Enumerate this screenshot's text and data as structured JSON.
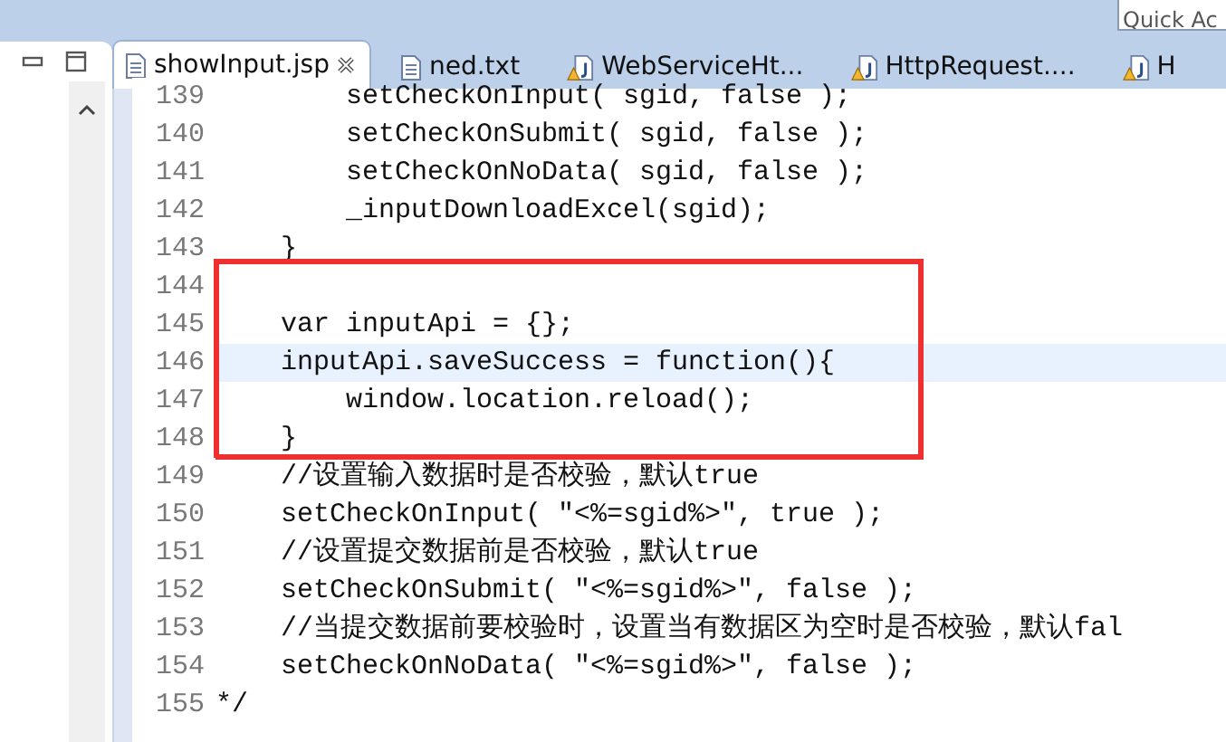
{
  "quick_access": {
    "placeholder": "Quick Ac"
  },
  "tabs": [
    {
      "label": "showInput.jsp",
      "kind": "text",
      "selected": true
    },
    {
      "label": "ned.txt",
      "kind": "text",
      "selected": false
    },
    {
      "label": "WebServiceHt...",
      "kind": "java",
      "selected": false
    },
    {
      "label": "HttpRequest....",
      "kind": "java",
      "selected": false
    },
    {
      "label": "H",
      "kind": "java",
      "selected": false
    }
  ],
  "editor": {
    "blocks": [
      {
        "boxed": false,
        "lines": [
          {
            "number": "139",
            "text": "        setCheckOnInput( sgid, false );",
            "current": false
          },
          {
            "number": "140",
            "text": "        setCheckOnSubmit( sgid, false );",
            "current": false
          },
          {
            "number": "141",
            "text": "        setCheckOnNoData( sgid, false );",
            "current": false
          },
          {
            "number": "142",
            "text": "        _inputDownloadExcel(sgid);",
            "current": false
          },
          {
            "number": "143",
            "text": "    }",
            "current": false
          }
        ]
      },
      {
        "boxed": true,
        "lines": [
          {
            "number": "144",
            "current": false
          },
          {
            "number": "145",
            "text": "    var inputApi = {};",
            "current": false
          },
          {
            "number": "146",
            "text": "    inputApi.saveSuccess = function(){",
            "current": true
          },
          {
            "number": "147",
            "text": "        window.location.reload();",
            "current": false
          },
          {
            "number": "148",
            "text": "    }",
            "current": false
          }
        ]
      },
      {
        "boxed": false,
        "lines": [
          {
            "number": "149",
            "text": "    //设置输入数据时是否校验，默认true",
            "current": false
          },
          {
            "number": "150",
            "text": "    setCheckOnInput( \"<%=sgid%>\", true );",
            "current": false
          },
          {
            "number": "151",
            "text": "    //设置提交数据前是否校验，默认true",
            "current": false
          },
          {
            "number": "152",
            "text": "    setCheckOnSubmit( \"<%=sgid%>\", false );",
            "current": false
          },
          {
            "number": "153",
            "text": "    //当提交数据前要校验时，设置当有数据区为空时是否校验，默认fal",
            "current": false
          },
          {
            "number": "154",
            "text": "    setCheckOnNoData( \"<%=sgid%>\", false );",
            "current": false
          },
          {
            "number": "155",
            "text": "*/",
            "current": false
          }
        ]
      }
    ]
  }
}
